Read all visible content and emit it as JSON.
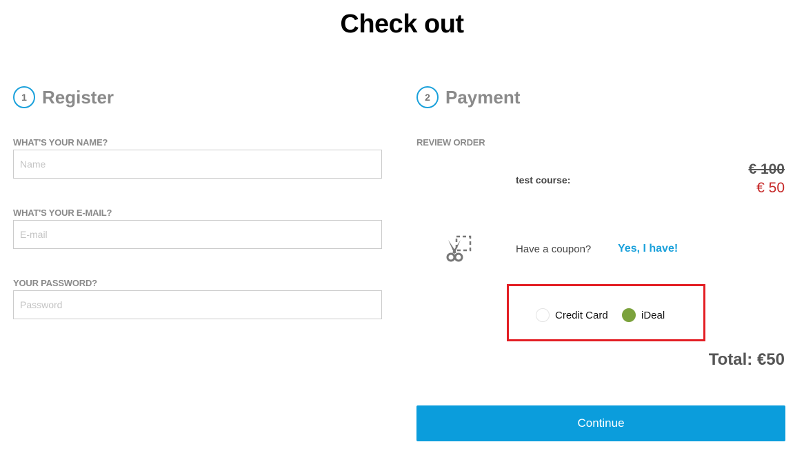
{
  "page": {
    "title": "Check out"
  },
  "register": {
    "step_number": "1",
    "title": "Register",
    "fields": [
      {
        "label": "WHAT'S YOUR NAME?",
        "placeholder": "Name",
        "value": ""
      },
      {
        "label": "WHAT'S YOUR E-MAIL?",
        "placeholder": "E-mail",
        "value": ""
      },
      {
        "label": "YOUR PASSWORD?",
        "placeholder": "Password",
        "value": ""
      }
    ]
  },
  "payment": {
    "step_number": "2",
    "title": "Payment",
    "review_label": "REVIEW ORDER",
    "order": {
      "item_name": "test course:",
      "original_price": "€ 100",
      "discounted_price": "€ 50"
    },
    "coupon": {
      "icon": "scissors-coupon-icon",
      "question": "Have a coupon?",
      "link_label": "Yes, I have!"
    },
    "methods": [
      {
        "label": "Credit Card",
        "selected": false
      },
      {
        "label": "iDeal",
        "selected": true
      }
    ],
    "total": "Total: €50",
    "continue_label": "Continue"
  },
  "colors": {
    "accent": "#1ba1db",
    "button": "#0b9ddc",
    "discount_price": "#c62828",
    "selected_radio": "#7ba23c",
    "highlight_border": "#e31e24"
  }
}
